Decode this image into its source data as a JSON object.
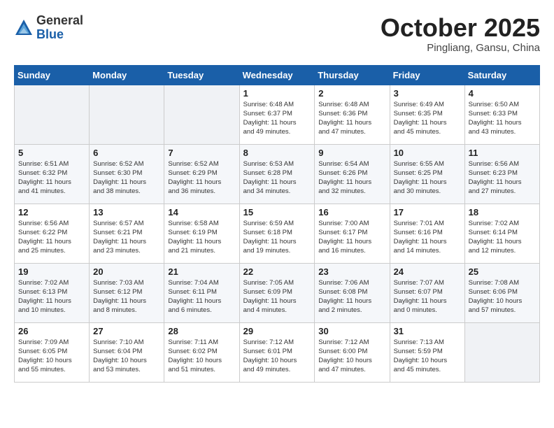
{
  "header": {
    "logo_general": "General",
    "logo_blue": "Blue",
    "month": "October 2025",
    "location": "Pingliang, Gansu, China"
  },
  "weekdays": [
    "Sunday",
    "Monday",
    "Tuesday",
    "Wednesday",
    "Thursday",
    "Friday",
    "Saturday"
  ],
  "weeks": [
    [
      {
        "day": "",
        "info": ""
      },
      {
        "day": "",
        "info": ""
      },
      {
        "day": "",
        "info": ""
      },
      {
        "day": "1",
        "info": "Sunrise: 6:48 AM\nSunset: 6:37 PM\nDaylight: 11 hours\nand 49 minutes."
      },
      {
        "day": "2",
        "info": "Sunrise: 6:48 AM\nSunset: 6:36 PM\nDaylight: 11 hours\nand 47 minutes."
      },
      {
        "day": "3",
        "info": "Sunrise: 6:49 AM\nSunset: 6:35 PM\nDaylight: 11 hours\nand 45 minutes."
      },
      {
        "day": "4",
        "info": "Sunrise: 6:50 AM\nSunset: 6:33 PM\nDaylight: 11 hours\nand 43 minutes."
      }
    ],
    [
      {
        "day": "5",
        "info": "Sunrise: 6:51 AM\nSunset: 6:32 PM\nDaylight: 11 hours\nand 41 minutes."
      },
      {
        "day": "6",
        "info": "Sunrise: 6:52 AM\nSunset: 6:30 PM\nDaylight: 11 hours\nand 38 minutes."
      },
      {
        "day": "7",
        "info": "Sunrise: 6:52 AM\nSunset: 6:29 PM\nDaylight: 11 hours\nand 36 minutes."
      },
      {
        "day": "8",
        "info": "Sunrise: 6:53 AM\nSunset: 6:28 PM\nDaylight: 11 hours\nand 34 minutes."
      },
      {
        "day": "9",
        "info": "Sunrise: 6:54 AM\nSunset: 6:26 PM\nDaylight: 11 hours\nand 32 minutes."
      },
      {
        "day": "10",
        "info": "Sunrise: 6:55 AM\nSunset: 6:25 PM\nDaylight: 11 hours\nand 30 minutes."
      },
      {
        "day": "11",
        "info": "Sunrise: 6:56 AM\nSunset: 6:23 PM\nDaylight: 11 hours\nand 27 minutes."
      }
    ],
    [
      {
        "day": "12",
        "info": "Sunrise: 6:56 AM\nSunset: 6:22 PM\nDaylight: 11 hours\nand 25 minutes."
      },
      {
        "day": "13",
        "info": "Sunrise: 6:57 AM\nSunset: 6:21 PM\nDaylight: 11 hours\nand 23 minutes."
      },
      {
        "day": "14",
        "info": "Sunrise: 6:58 AM\nSunset: 6:19 PM\nDaylight: 11 hours\nand 21 minutes."
      },
      {
        "day": "15",
        "info": "Sunrise: 6:59 AM\nSunset: 6:18 PM\nDaylight: 11 hours\nand 19 minutes."
      },
      {
        "day": "16",
        "info": "Sunrise: 7:00 AM\nSunset: 6:17 PM\nDaylight: 11 hours\nand 16 minutes."
      },
      {
        "day": "17",
        "info": "Sunrise: 7:01 AM\nSunset: 6:16 PM\nDaylight: 11 hours\nand 14 minutes."
      },
      {
        "day": "18",
        "info": "Sunrise: 7:02 AM\nSunset: 6:14 PM\nDaylight: 11 hours\nand 12 minutes."
      }
    ],
    [
      {
        "day": "19",
        "info": "Sunrise: 7:02 AM\nSunset: 6:13 PM\nDaylight: 11 hours\nand 10 minutes."
      },
      {
        "day": "20",
        "info": "Sunrise: 7:03 AM\nSunset: 6:12 PM\nDaylight: 11 hours\nand 8 minutes."
      },
      {
        "day": "21",
        "info": "Sunrise: 7:04 AM\nSunset: 6:11 PM\nDaylight: 11 hours\nand 6 minutes."
      },
      {
        "day": "22",
        "info": "Sunrise: 7:05 AM\nSunset: 6:09 PM\nDaylight: 11 hours\nand 4 minutes."
      },
      {
        "day": "23",
        "info": "Sunrise: 7:06 AM\nSunset: 6:08 PM\nDaylight: 11 hours\nand 2 minutes."
      },
      {
        "day": "24",
        "info": "Sunrise: 7:07 AM\nSunset: 6:07 PM\nDaylight: 11 hours\nand 0 minutes."
      },
      {
        "day": "25",
        "info": "Sunrise: 7:08 AM\nSunset: 6:06 PM\nDaylight: 10 hours\nand 57 minutes."
      }
    ],
    [
      {
        "day": "26",
        "info": "Sunrise: 7:09 AM\nSunset: 6:05 PM\nDaylight: 10 hours\nand 55 minutes."
      },
      {
        "day": "27",
        "info": "Sunrise: 7:10 AM\nSunset: 6:04 PM\nDaylight: 10 hours\nand 53 minutes."
      },
      {
        "day": "28",
        "info": "Sunrise: 7:11 AM\nSunset: 6:02 PM\nDaylight: 10 hours\nand 51 minutes."
      },
      {
        "day": "29",
        "info": "Sunrise: 7:12 AM\nSunset: 6:01 PM\nDaylight: 10 hours\nand 49 minutes."
      },
      {
        "day": "30",
        "info": "Sunrise: 7:12 AM\nSunset: 6:00 PM\nDaylight: 10 hours\nand 47 minutes."
      },
      {
        "day": "31",
        "info": "Sunrise: 7:13 AM\nSunset: 5:59 PM\nDaylight: 10 hours\nand 45 minutes."
      },
      {
        "day": "",
        "info": ""
      }
    ]
  ]
}
